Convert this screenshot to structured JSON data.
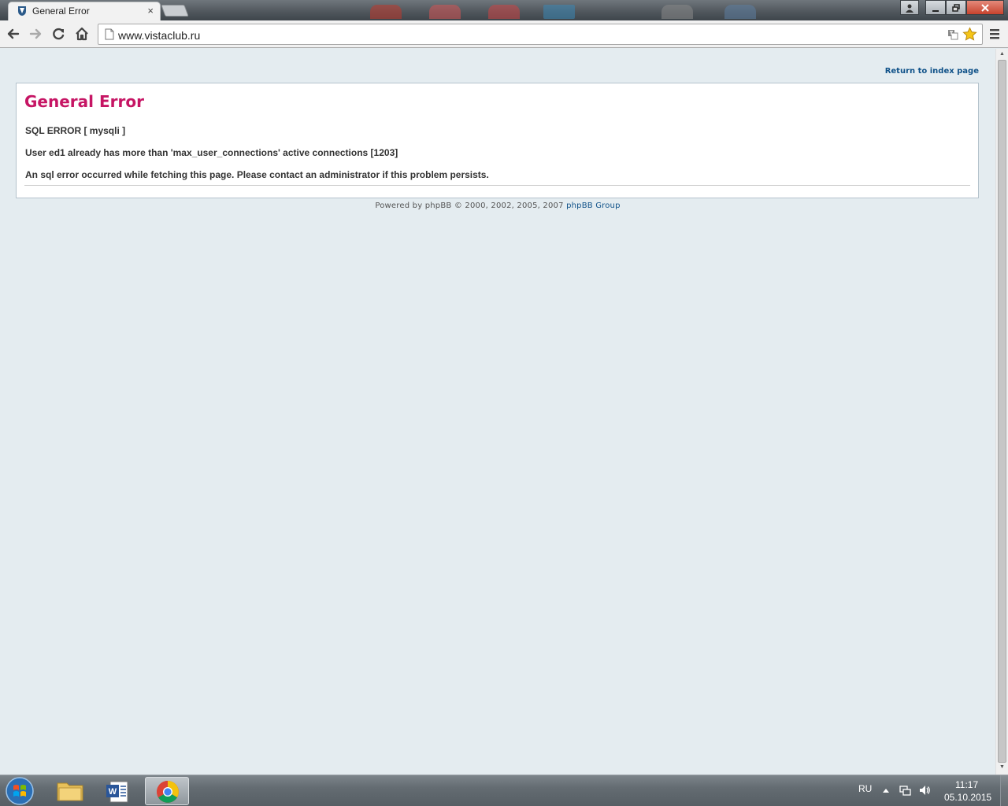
{
  "browser": {
    "tab_title": "General Error",
    "tab_close": "×",
    "url": "www.vistaclub.ru"
  },
  "page": {
    "return_link": "Return to index page",
    "error_title": "General Error",
    "messages": [
      "SQL ERROR [ mysqli ]",
      "User ed1 already has more than 'max_user_connections' active connections [1203]",
      "An sql error occurred while fetching this page. Please contact an administrator if this problem persists."
    ],
    "footer_prefix": "Powered by phpBB © 2000, 2002, 2005, 2007 ",
    "footer_link": "phpBB Group"
  },
  "taskbar": {
    "language": "RU",
    "time": "11:17",
    "date": "05.10.2015"
  },
  "colors": {
    "page_bg": "#e4ecf0",
    "title": "#c61564",
    "link": "#105289"
  }
}
